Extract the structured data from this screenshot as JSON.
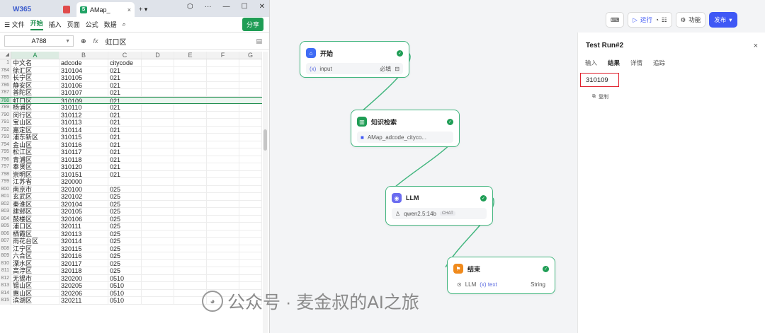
{
  "browser": {
    "logo_tab": "W365",
    "file_tab": "AMap_",
    "file_icon": "S"
  },
  "menu": {
    "file": "☰ 文件",
    "items": [
      "开始",
      "插入",
      "页面",
      "公式",
      "数据"
    ],
    "active": "开始",
    "share": "分享"
  },
  "formula_bar": {
    "cell_ref": "A788",
    "fx": "fx",
    "value": "虹口区"
  },
  "sheet": {
    "columns": [
      "A",
      "B",
      "C",
      "D",
      "E",
      "F",
      "G"
    ],
    "header_row": {
      "num": "1",
      "a": "中文名",
      "b": "adcode",
      "c": "citycode"
    },
    "selected_row": "788",
    "rows": [
      {
        "num": "784",
        "a": "徐汇区",
        "b": "310104",
        "c": "021"
      },
      {
        "num": "785",
        "a": "长宁区",
        "b": "310105",
        "c": "021"
      },
      {
        "num": "786",
        "a": "静安区",
        "b": "310106",
        "c": "021"
      },
      {
        "num": "787",
        "a": "普陀区",
        "b": "310107",
        "c": "021"
      },
      {
        "num": "788",
        "a": "虹口区",
        "b": "310109",
        "c": "021"
      },
      {
        "num": "789",
        "a": "杨浦区",
        "b": "310110",
        "c": "021"
      },
      {
        "num": "790",
        "a": "闵行区",
        "b": "310112",
        "c": "021"
      },
      {
        "num": "791",
        "a": "宝山区",
        "b": "310113",
        "c": "021"
      },
      {
        "num": "792",
        "a": "嘉定区",
        "b": "310114",
        "c": "021"
      },
      {
        "num": "793",
        "a": "浦东新区",
        "b": "310115",
        "c": "021"
      },
      {
        "num": "794",
        "a": "金山区",
        "b": "310116",
        "c": "021"
      },
      {
        "num": "795",
        "a": "松江区",
        "b": "310117",
        "c": "021"
      },
      {
        "num": "796",
        "a": "青浦区",
        "b": "310118",
        "c": "021"
      },
      {
        "num": "797",
        "a": "奉贤区",
        "b": "310120",
        "c": "021"
      },
      {
        "num": "798",
        "a": "崇明区",
        "b": "310151",
        "c": "021"
      },
      {
        "num": "799",
        "a": "江苏省",
        "b": "320000",
        "c": ""
      },
      {
        "num": "800",
        "a": "南京市",
        "b": "320100",
        "c": "025"
      },
      {
        "num": "801",
        "a": "玄武区",
        "b": "320102",
        "c": "025"
      },
      {
        "num": "802",
        "a": "秦淮区",
        "b": "320104",
        "c": "025"
      },
      {
        "num": "803",
        "a": "建邺区",
        "b": "320105",
        "c": "025"
      },
      {
        "num": "804",
        "a": "鼓楼区",
        "b": "320106",
        "c": "025"
      },
      {
        "num": "805",
        "a": "浦口区",
        "b": "320111",
        "c": "025"
      },
      {
        "num": "806",
        "a": "栖霞区",
        "b": "320113",
        "c": "025"
      },
      {
        "num": "807",
        "a": "雨花台区",
        "b": "320114",
        "c": "025"
      },
      {
        "num": "808",
        "a": "江宁区",
        "b": "320115",
        "c": "025"
      },
      {
        "num": "809",
        "a": "六合区",
        "b": "320116",
        "c": "025"
      },
      {
        "num": "810",
        "a": "溧水区",
        "b": "320117",
        "c": "025"
      },
      {
        "num": "811",
        "a": "高淳区",
        "b": "320118",
        "c": "025"
      },
      {
        "num": "812",
        "a": "无锡市",
        "b": "320200",
        "c": "0510"
      },
      {
        "num": "813",
        "a": "锡山区",
        "b": "320205",
        "c": "0510"
      },
      {
        "num": "814",
        "a": "惠山区",
        "b": "320206",
        "c": "0510"
      },
      {
        "num": "815",
        "a": "滨湖区",
        "b": "320211",
        "c": "0510"
      }
    ]
  },
  "workflow": {
    "accent": "#43b67f",
    "nodes": {
      "start": {
        "title": "开始",
        "var": "(x)",
        "field": "input",
        "required": "必填"
      },
      "knowledge": {
        "title": "知识检索",
        "dataset": "AMap_adcode_cityco..."
      },
      "llm": {
        "title": "LLM",
        "model": "qwen2.5:14b",
        "mode": "CHAT"
      },
      "end": {
        "title": "结束",
        "source": "LLM",
        "var": "(x) text",
        "type": "String"
      }
    }
  },
  "toolbar": {
    "run": "运行",
    "features": "功能",
    "publish": "发布"
  },
  "test_run": {
    "title": "Test Run#2",
    "tabs": [
      "输入",
      "结果",
      "详情",
      "追踪"
    ],
    "active_tab": "结果",
    "result": "310109",
    "copy": "复制"
  },
  "watermark": "公众号 · 麦金叔的AI之旅"
}
